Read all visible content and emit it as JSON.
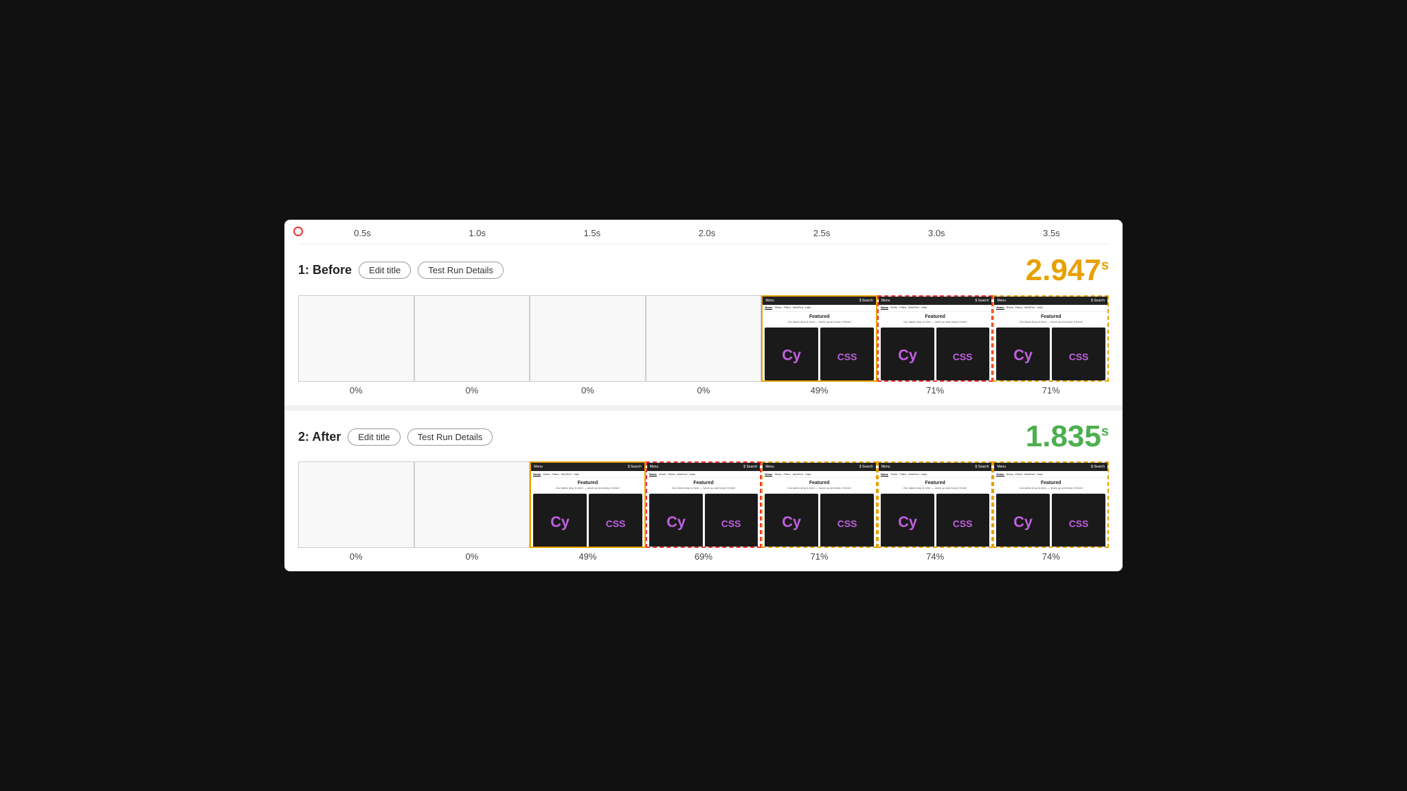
{
  "timeline": {
    "ticks": [
      "0.5s",
      "1.0s",
      "1.5s",
      "2.0s",
      "2.5s",
      "3.0s",
      "3.5s"
    ]
  },
  "before": {
    "title": "1: Before",
    "edit_label": "Edit title",
    "details_label": "Test Run Details",
    "score": "2.947",
    "score_unit": "s",
    "frames": [
      {
        "pct": "0%",
        "type": "empty"
      },
      {
        "pct": "0%",
        "type": "empty"
      },
      {
        "pct": "0%",
        "type": "empty"
      },
      {
        "pct": "0%",
        "type": "empty"
      },
      {
        "pct": "49%",
        "type": "browser",
        "highlight": "yellow"
      },
      {
        "pct": "71%",
        "type": "browser",
        "highlight": "red"
      },
      {
        "pct": "71%",
        "type": "browser",
        "highlight": "yellow-dash"
      }
    ]
  },
  "after": {
    "title": "2: After",
    "edit_label": "Edit title",
    "details_label": "Test Run Details",
    "score": "1.835",
    "score_unit": "s",
    "frames": [
      {
        "pct": "0%",
        "type": "empty"
      },
      {
        "pct": "0%",
        "type": "empty"
      },
      {
        "pct": "49%",
        "type": "browser",
        "highlight": "yellow"
      },
      {
        "pct": "69%",
        "type": "browser",
        "highlight": "red"
      },
      {
        "pct": "71%",
        "type": "browser",
        "highlight": "yellow-dash2"
      },
      {
        "pct": "74%",
        "type": "browser",
        "highlight": "yellow-dash2"
      },
      {
        "pct": "74%",
        "type": "browser",
        "highlight": "yellow-dash2"
      }
    ]
  }
}
